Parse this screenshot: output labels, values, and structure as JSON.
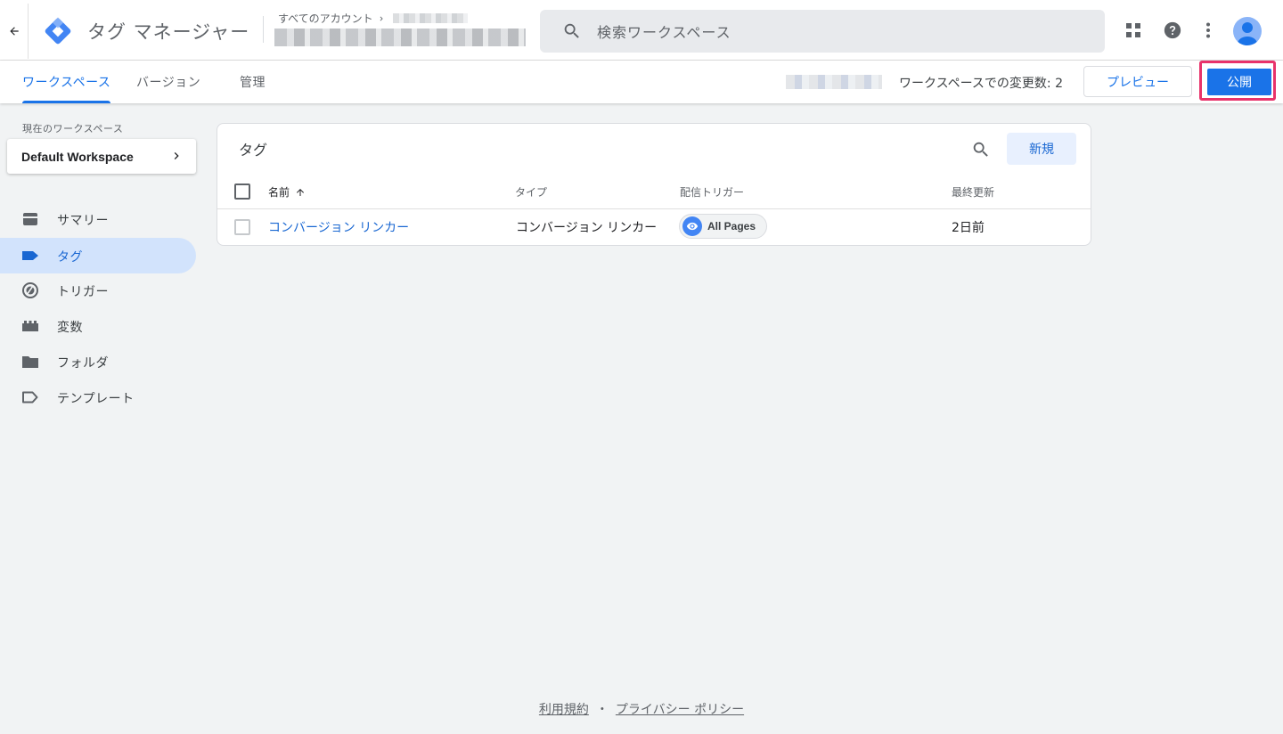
{
  "header": {
    "app_title": "タグ マネージャー",
    "breadcrumb_label": "すべてのアカウント",
    "search_placeholder": "検索ワークスペース"
  },
  "tabs": [
    {
      "label": "ワークスペース",
      "active": true
    },
    {
      "label": "バージョン",
      "active": false
    },
    {
      "label": "管理",
      "active": false
    }
  ],
  "toolbar": {
    "changes_text": "ワークスペースでの変更数: 2",
    "preview_label": "プレビュー",
    "publish_label": "公開"
  },
  "sidebar": {
    "workspace_label": "現在のワークスペース",
    "workspace_name": "Default Workspace",
    "items": [
      {
        "label": "サマリー",
        "icon": "summary-icon",
        "active": false
      },
      {
        "label": "タグ",
        "icon": "tag-icon",
        "active": true
      },
      {
        "label": "トリガー",
        "icon": "trigger-icon",
        "active": false
      },
      {
        "label": "変数",
        "icon": "variables-icon",
        "active": false
      },
      {
        "label": "フォルダ",
        "icon": "folder-icon",
        "active": false
      },
      {
        "label": "テンプレート",
        "icon": "template-icon",
        "active": false
      }
    ]
  },
  "tags_card": {
    "title": "タグ",
    "new_label": "新規",
    "columns": [
      "名前",
      "タイプ",
      "配信トリガー",
      "最終更新"
    ],
    "rows": [
      {
        "name": "コンバージョン リンカー",
        "type": "コンバージョン リンカー",
        "trigger": "All Pages",
        "updated": "2日前"
      }
    ]
  },
  "footer": {
    "terms": "利用規約",
    "separator": "・",
    "privacy": "プライバシー ポリシー"
  },
  "colors": {
    "accent": "#1a73e8",
    "highlight_border": "#e8336b",
    "active_nav_bg": "#d2e3fc",
    "page_bg": "#f1f3f4"
  }
}
